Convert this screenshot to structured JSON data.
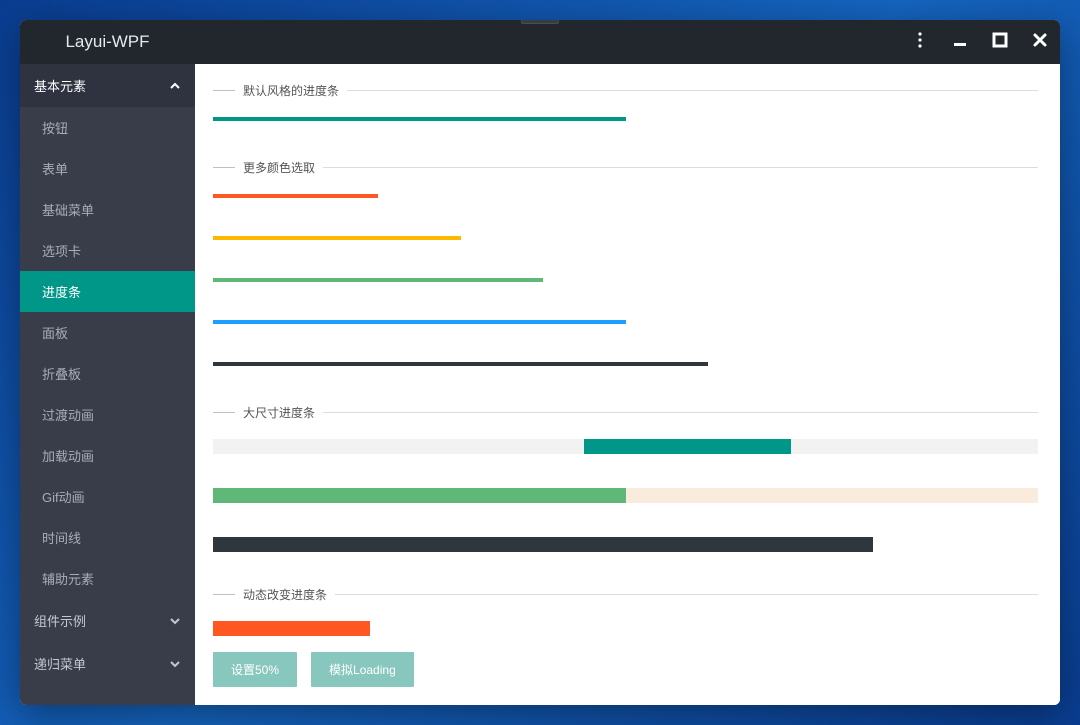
{
  "title": "Layui-WPF",
  "sidebar": {
    "group1": {
      "label": "基本元素",
      "expanded": true
    },
    "items": [
      {
        "label": "按钮"
      },
      {
        "label": "表单"
      },
      {
        "label": "基础菜单"
      },
      {
        "label": "选项卡"
      },
      {
        "label": "进度条",
        "active": true
      },
      {
        "label": "面板"
      },
      {
        "label": "折叠板"
      },
      {
        "label": "过渡动画"
      },
      {
        "label": "加载动画"
      },
      {
        "label": "Gif动画"
      },
      {
        "label": "时间线"
      },
      {
        "label": "辅助元素"
      }
    ],
    "group2": {
      "label": "组件示例",
      "expanded": false
    },
    "group3": {
      "label": "递归菜单",
      "expanded": false
    }
  },
  "sections": {
    "default_style": {
      "title": "默认风格的进度条",
      "bars": [
        {
          "percent": 50,
          "color": "#009688"
        }
      ]
    },
    "more_colors": {
      "title": "更多颜色选取",
      "bars": [
        {
          "percent": 20,
          "color": "#FF5722"
        },
        {
          "percent": 30,
          "color": "#FFB800"
        },
        {
          "percent": 40,
          "color": "#5FB878"
        },
        {
          "percent": 50,
          "color": "#1E9FFF"
        },
        {
          "percent": 60,
          "color": "#2F363C"
        }
      ]
    },
    "large_size": {
      "title": "大尺寸进度条",
      "bars": [
        {
          "percent": 25,
          "offset": 45,
          "color": "#009688",
          "track": "grey"
        },
        {
          "percent": 50,
          "offset": 0,
          "color": "#5FB878",
          "track": "beige"
        },
        {
          "percent": 80,
          "offset": 0,
          "color": "#2F363C",
          "track": "white"
        }
      ]
    },
    "dynamic": {
      "title": "动态改变进度条",
      "bar": {
        "percent": 19,
        "color": "#FF5722"
      },
      "buttons": {
        "set50": "设置50%",
        "loading": "模拟Loading"
      }
    }
  },
  "colors": {
    "teal": "#009688",
    "sidebar_bg": "#393d49",
    "titlebar_bg": "#22272e"
  }
}
